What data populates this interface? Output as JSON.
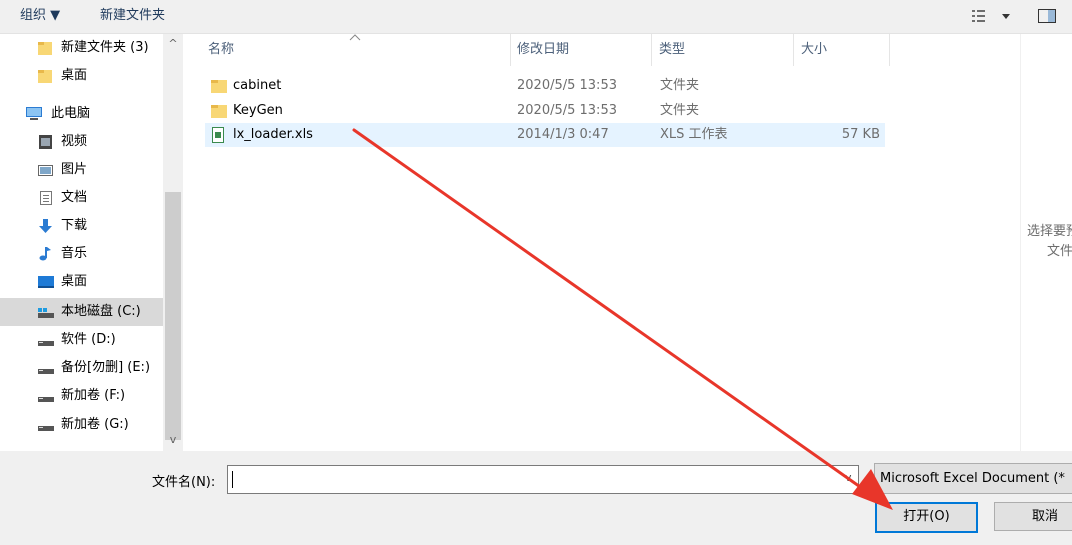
{
  "toolbar": {
    "organize": "组织 ▼",
    "new_folder": "新建文件夹"
  },
  "nav": {
    "items": [
      {
        "label": "新建文件夹 (3)",
        "icon": "folder-icon"
      },
      {
        "label": "桌面",
        "icon": "folder-icon"
      },
      {
        "label": "此电脑",
        "icon": "computer-icon"
      },
      {
        "label": "视频",
        "icon": "video-icon"
      },
      {
        "label": "图片",
        "icon": "picture-icon"
      },
      {
        "label": "文档",
        "icon": "document-icon"
      },
      {
        "label": "下载",
        "icon": "download-icon"
      },
      {
        "label": "音乐",
        "icon": "music-icon"
      },
      {
        "label": "桌面",
        "icon": "desktop-icon"
      },
      {
        "label": "本地磁盘 (C:)",
        "icon": "drive-icon"
      },
      {
        "label": "软件 (D:)",
        "icon": "drive-icon"
      },
      {
        "label": "备份[勿删] (E:)",
        "icon": "drive-icon"
      },
      {
        "label": "新加卷 (F:)",
        "icon": "drive-icon"
      },
      {
        "label": "新加卷 (G:)",
        "icon": "drive-icon"
      }
    ]
  },
  "columns": {
    "name": "名称",
    "modified": "修改日期",
    "type": "类型",
    "size": "大小"
  },
  "files": [
    {
      "name": "cabinet",
      "modified": "2020/5/5 13:53",
      "type": "文件夹",
      "size": "",
      "icon": "folder-icon"
    },
    {
      "name": "KeyGen",
      "modified": "2020/5/5 13:53",
      "type": "文件夹",
      "size": "",
      "icon": "folder-icon"
    },
    {
      "name": "lx_loader.xls",
      "modified": "2014/1/3 0:47",
      "type": "XLS 工作表",
      "size": "57 KB",
      "icon": "excel-file-icon"
    }
  ],
  "preview": {
    "line1": "选择要预",
    "line2": "文件"
  },
  "bottom": {
    "filename_label": "文件名(N):",
    "filename_value": "",
    "filter_value": "Microsoft Excel Document (*",
    "open_button": "打开(O)",
    "cancel_button": "取消"
  },
  "colors": {
    "accent": "#0078d7",
    "selection": "#e5f3ff",
    "annotation_arrow": "#e8362a",
    "folder": "#f8d775"
  }
}
